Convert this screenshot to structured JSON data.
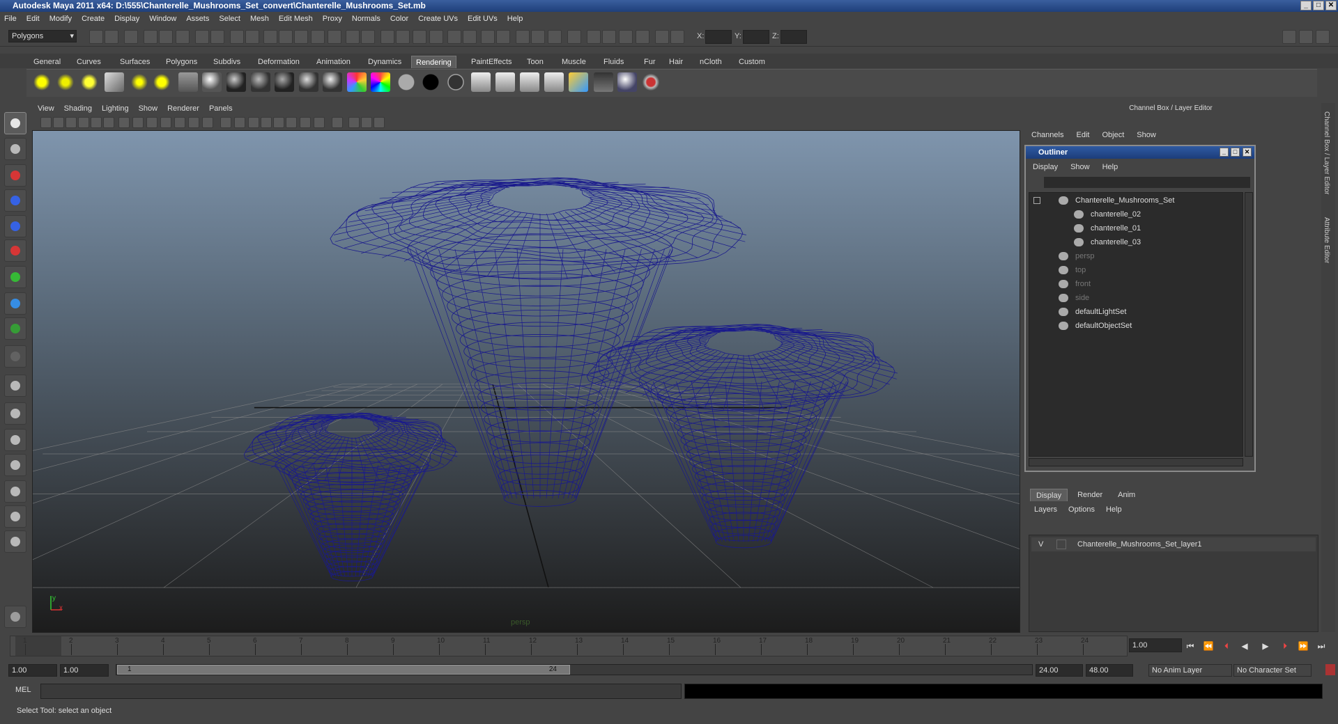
{
  "window": {
    "title": "Autodesk Maya 2011 x64: D:\\555\\Chanterelle_Mushrooms_Set_convert\\Chanterelle_Mushrooms_Set.mb",
    "minimize": "_",
    "maximize": "□",
    "close": "✕"
  },
  "menus": [
    "File",
    "Edit",
    "Modify",
    "Create",
    "Display",
    "Window",
    "Assets",
    "Select",
    "Mesh",
    "Edit Mesh",
    "Proxy",
    "Normals",
    "Color",
    "Create UVs",
    "Edit UVs",
    "Help"
  ],
  "statusline": {
    "menuset": "Polygons",
    "x_label": "X:",
    "y_label": "Y:",
    "z_label": "Z:"
  },
  "shelf": {
    "tabs": [
      "General",
      "Curves",
      "Surfaces",
      "Polygons",
      "Subdivs",
      "Deformation",
      "Animation",
      "Dynamics",
      "Rendering",
      "PaintEffects",
      "Toon",
      "Muscle",
      "Fluids",
      "Fur",
      "Hair",
      "nCloth",
      "Custom"
    ],
    "active": "Rendering"
  },
  "panel": {
    "menus": [
      "View",
      "Shading",
      "Lighting",
      "Show",
      "Renderer",
      "Panels"
    ],
    "camera_label": "persp",
    "axis_y": "y",
    "axis_x": "x"
  },
  "channelbox": {
    "title": "Channel Box / Layer Editor",
    "menus": [
      "Channels",
      "Edit",
      "Object",
      "Show"
    ]
  },
  "outliner": {
    "title": "Outliner",
    "menus": [
      "Display",
      "Show",
      "Help"
    ],
    "items": [
      {
        "label": "Chanterelle_Mushrooms_Set",
        "dim": false
      },
      {
        "label": "chanterelle_02",
        "dim": false
      },
      {
        "label": "chanterelle_01",
        "dim": false
      },
      {
        "label": "chanterelle_03",
        "dim": false
      },
      {
        "label": "persp",
        "dim": true
      },
      {
        "label": "top",
        "dim": true
      },
      {
        "label": "front",
        "dim": true
      },
      {
        "label": "side",
        "dim": true
      },
      {
        "label": "defaultLightSet",
        "dim": false
      },
      {
        "label": "defaultObjectSet",
        "dim": false
      }
    ]
  },
  "layers": {
    "tabs": [
      "Display",
      "Render",
      "Anim"
    ],
    "active": "Display",
    "menus": [
      "Layers",
      "Options",
      "Help"
    ],
    "rows": [
      {
        "visible": "V",
        "name": "Chanterelle_Mushrooms_Set_layer1"
      }
    ]
  },
  "side_tabs": [
    "Channel Box / Layer Editor",
    "Attribute Editor"
  ],
  "timeline": {
    "ticks": [
      "1",
      "2",
      "3",
      "4",
      "5",
      "6",
      "7",
      "8",
      "9",
      "10",
      "11",
      "12",
      "13",
      "14",
      "15",
      "16",
      "17",
      "18",
      "19",
      "20",
      "21",
      "22",
      "23",
      "24"
    ],
    "current_frame": "1.00"
  },
  "range": {
    "start": "1.00",
    "playback_start": "1.00",
    "thumb_start": "1",
    "thumb_end": "24",
    "playback_end": "24.00",
    "end": "48.00",
    "anim_layer": "No Anim Layer",
    "character_set": "No Character Set"
  },
  "command": {
    "label": "MEL"
  },
  "help_line": "Select Tool: select an object",
  "colors": {
    "wireframe": "#1a1a8c",
    "titlebar": "#2a4f8f",
    "viewport_top": "#7f95ad"
  }
}
